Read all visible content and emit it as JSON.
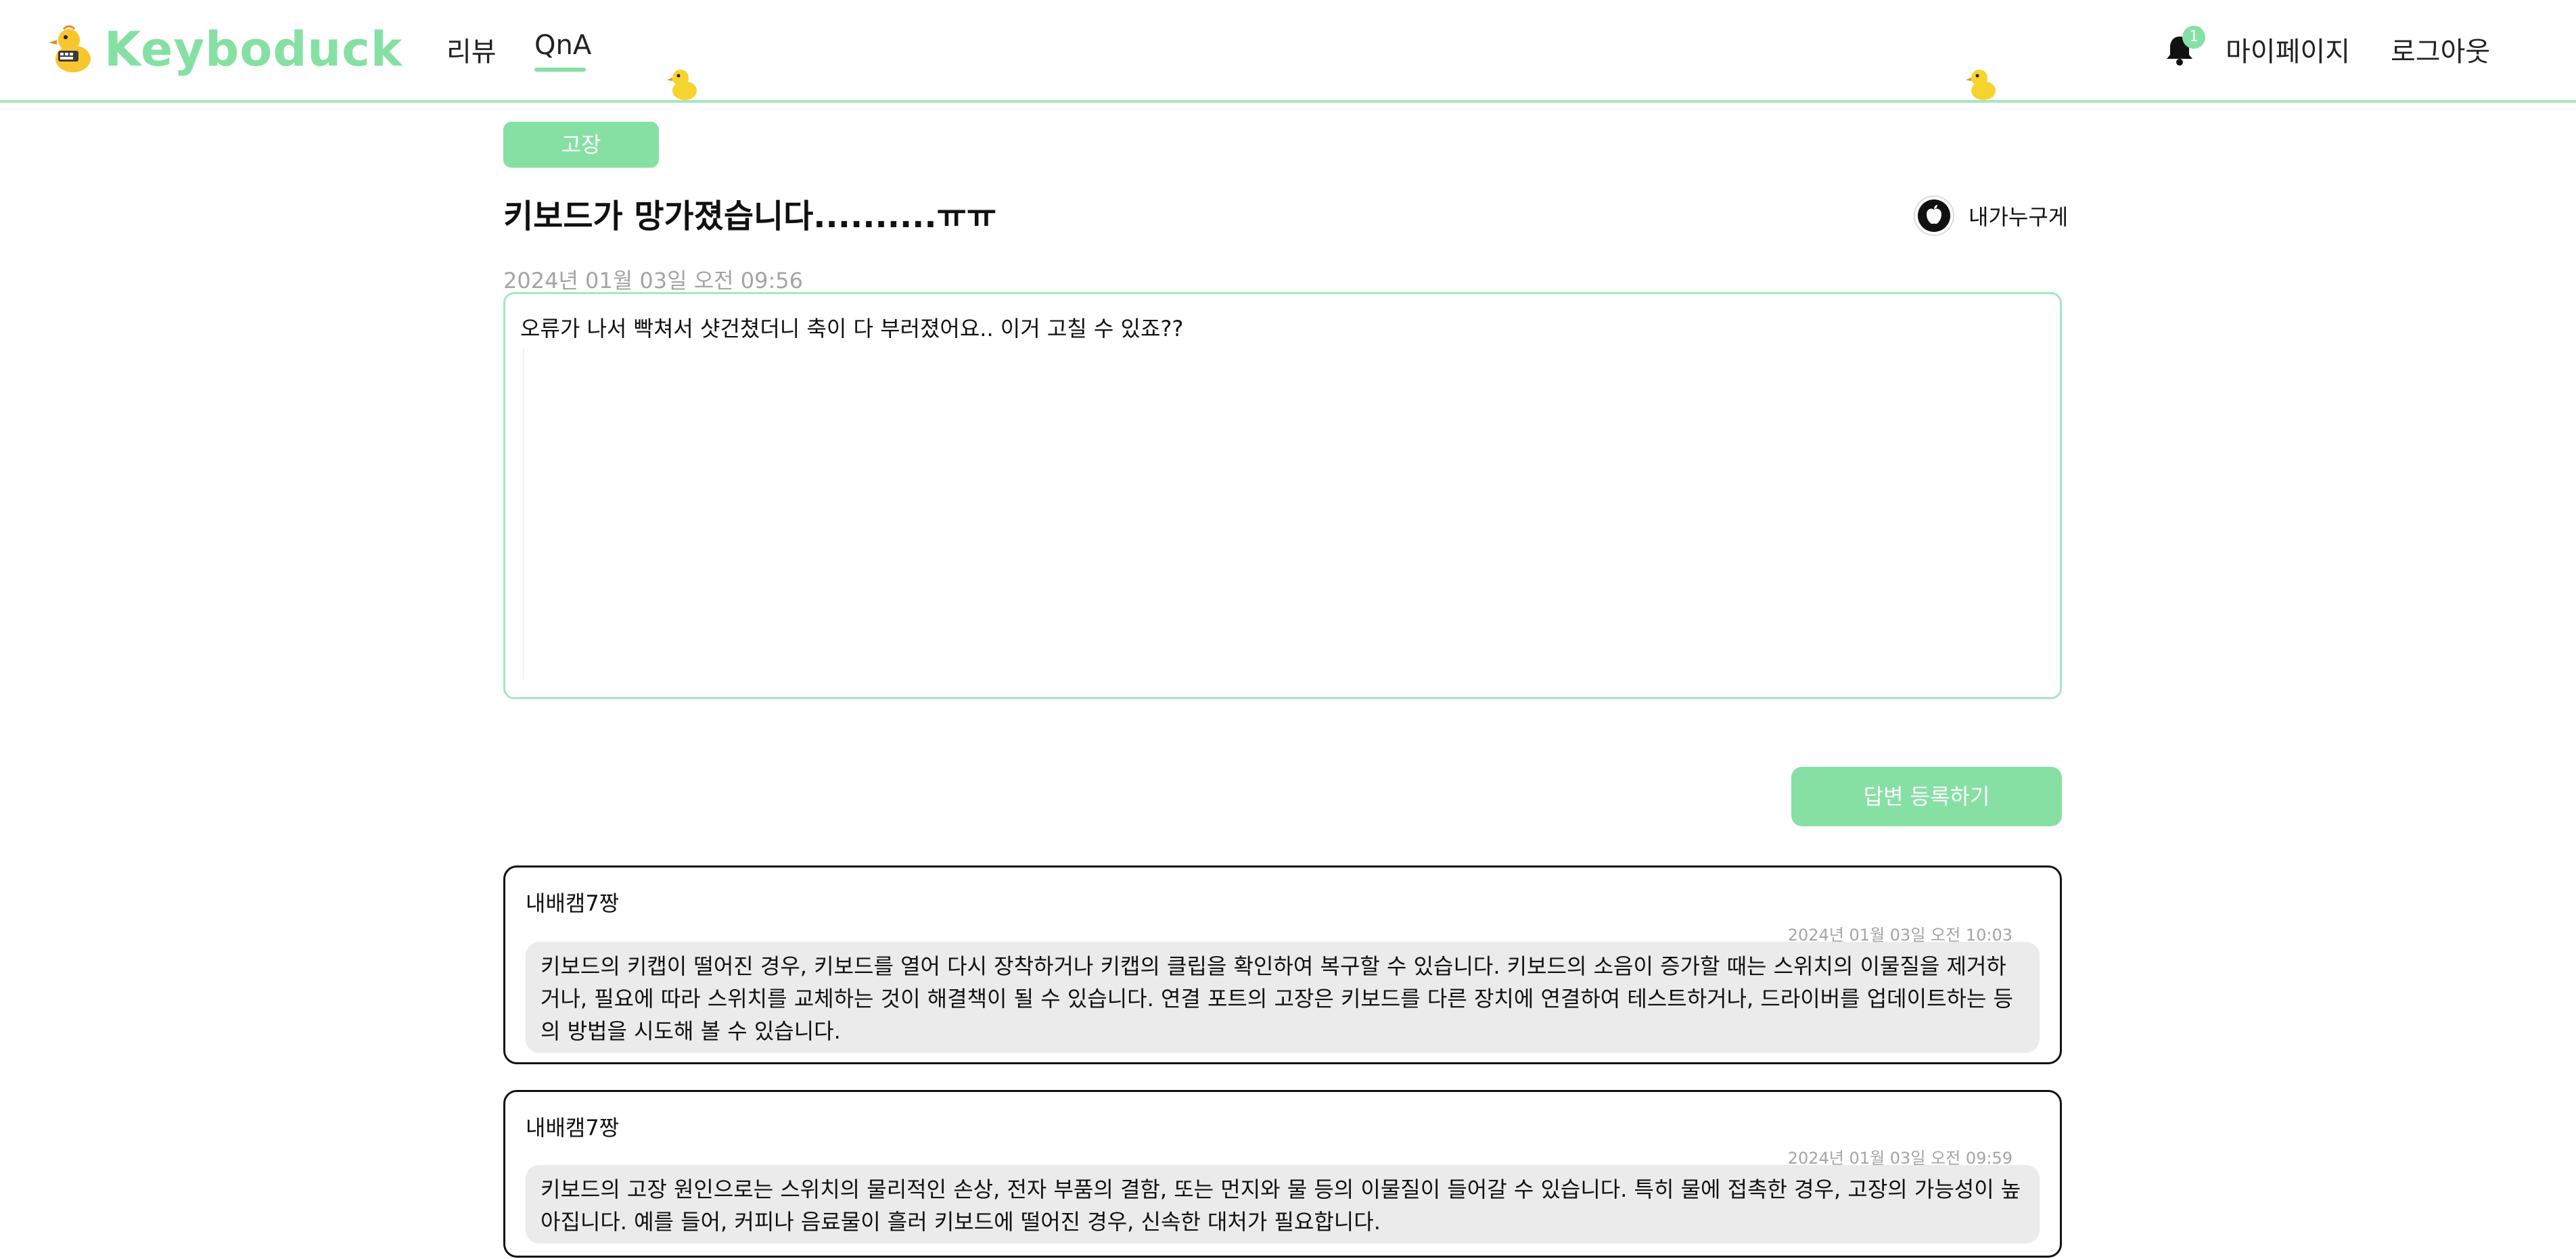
{
  "header": {
    "logo_text": "Keyboduck",
    "nav": [
      {
        "label": "리뷰"
      },
      {
        "label": "QnA"
      }
    ],
    "notification_count": "1",
    "mypage_label": "마이페이지",
    "logout_label": "로그아웃"
  },
  "post": {
    "tag": "고장",
    "title": "키보드가 망가졌습니다..........ㅠㅠ",
    "author": "내가누구게",
    "date": "2024년 01월 03일 오전 09:56",
    "content": "오류가 나서 빡쳐서 샷건쳤더니 축이 다 부러졌어요.. 이거 고칠 수 있죠??"
  },
  "answer_button_label": "답변 등록하기",
  "answers": [
    {
      "author": "내배캠7짱",
      "date": "2024년 01월 03일 오전 10:03",
      "body": "키보드의 키캡이 떨어진 경우, 키보드를 열어 다시 장착하거나 키캡의 클립을 확인하여 복구할 수 있습니다. 키보드의 소음이 증가할 때는 스위치의 이물질을 제거하거나, 필요에 따라 스위치를 교체하는 것이 해결책이 될 수 있습니다. 연결 포트의 고장은 키보드를 다른 장치에 연결하여 테스트하거나, 드라이버를 업데이트하는 등의 방법을 시도해 볼 수 있습니다."
    },
    {
      "author": "내배캠7짱",
      "date": "2024년 01월 03일 오전 09:59",
      "body": "키보드의 고장 원인으로는 스위치의 물리적인 손상, 전자 부품의 결함, 또는 먼지와 물 등의 이물질이 들어갈 수 있습니다. 특히 물에 접촉한 경우, 고장의 가능성이 높아집니다. 예를 들어, 커피나 음료물이 흘러 키보드에 떨어진 경우, 신속한 대처가 필요합니다."
    }
  ],
  "colors": {
    "accent": "#86e0a4",
    "border_light": "#a6e6c0",
    "muted_text": "#a4a4a4",
    "answer_bg": "#ebebeb"
  },
  "icons": {
    "logo": "duck-logo-icon",
    "decoration": "duck-icon",
    "notification": "bell-icon",
    "author_avatar": "apple-icon"
  }
}
